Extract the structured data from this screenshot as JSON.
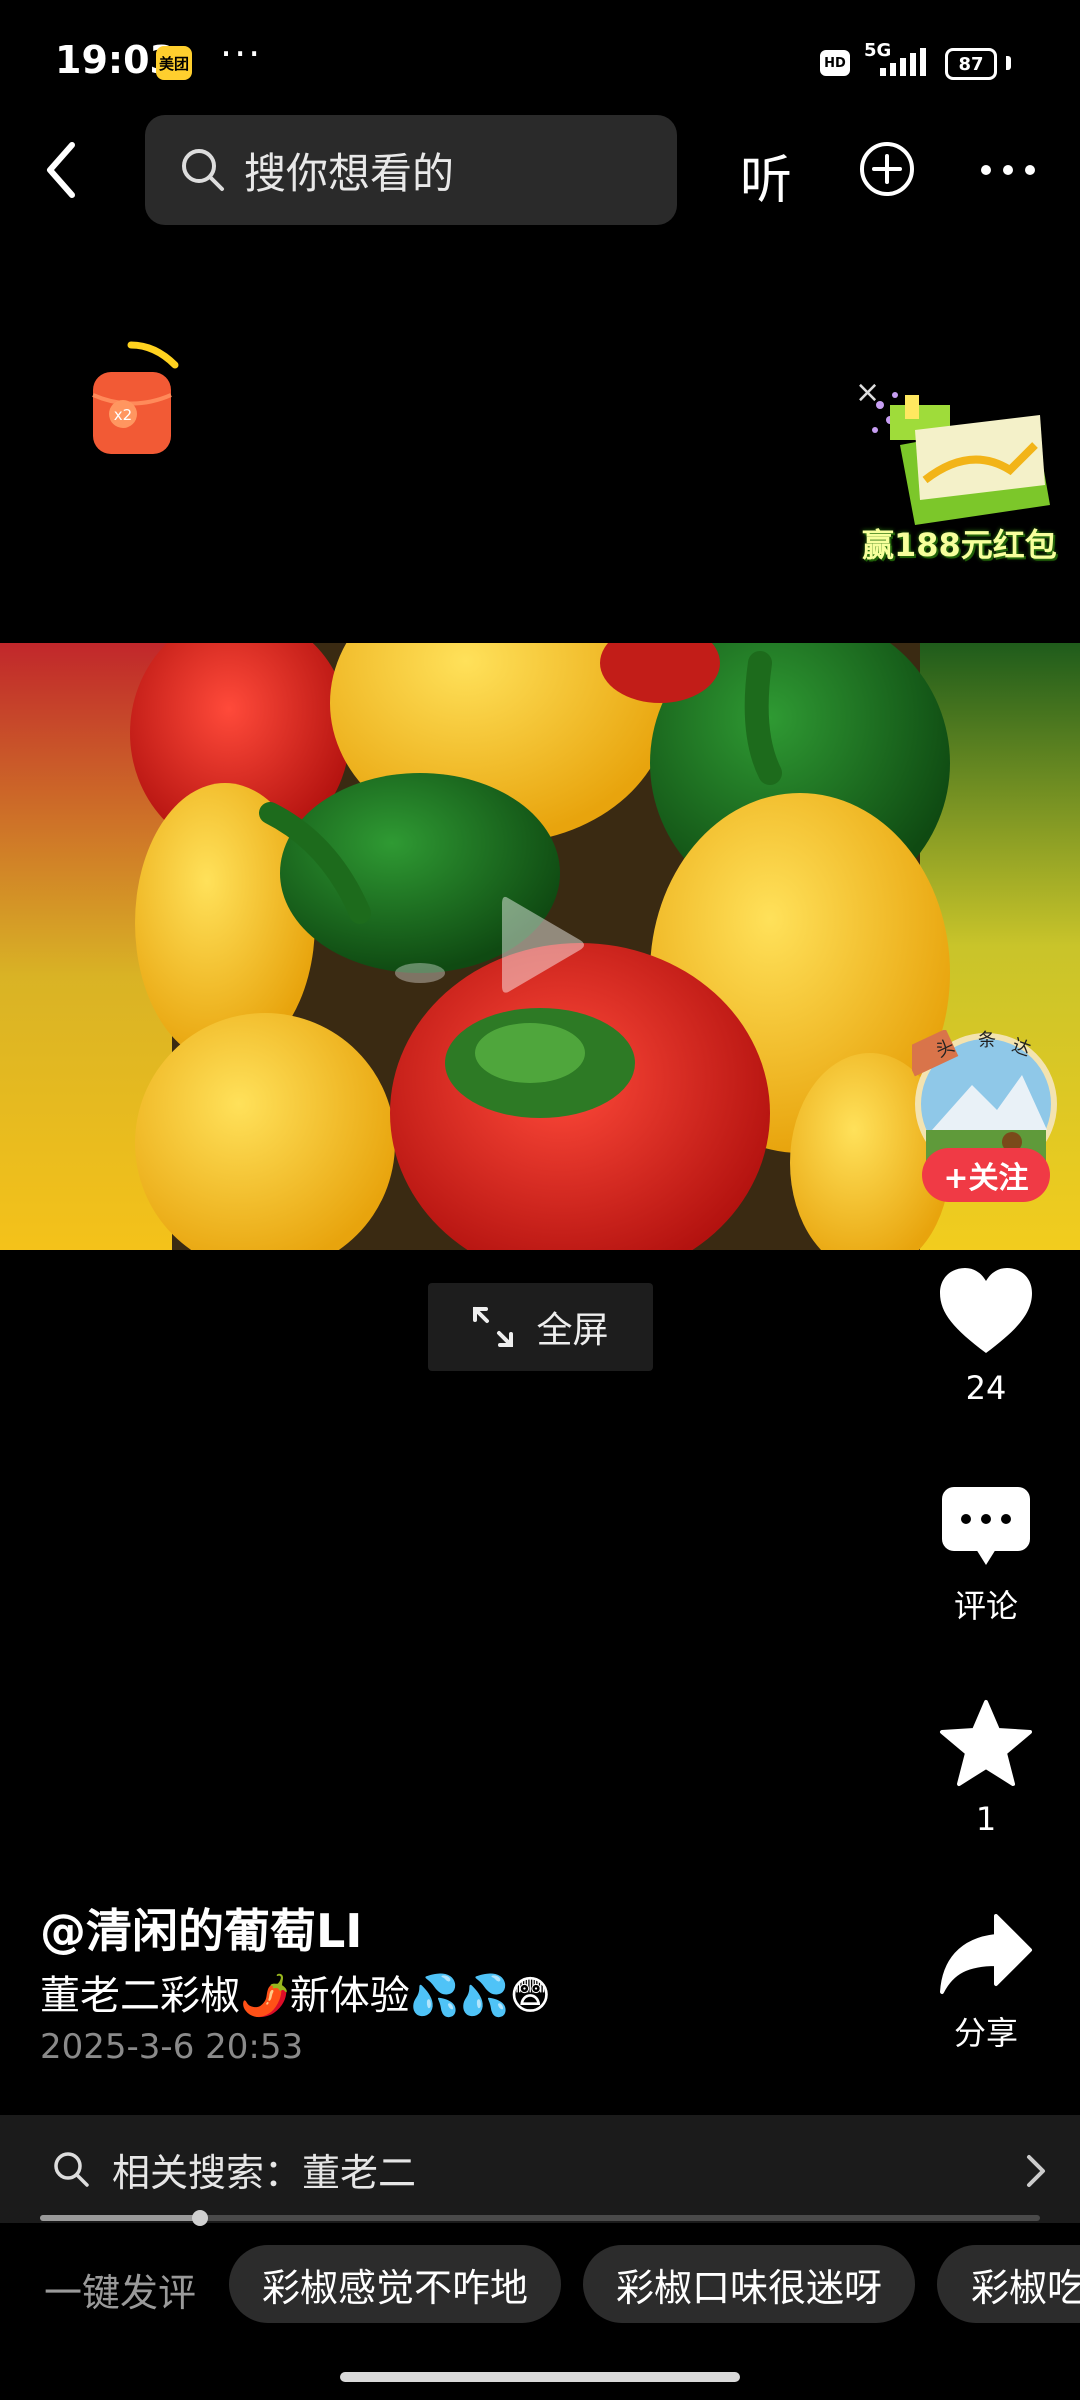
{
  "status_bar": {
    "time": "19:03",
    "app_badge": "美团",
    "more": "···",
    "hd": "HD",
    "network": "5G",
    "battery": "87"
  },
  "nav": {
    "search_placeholder": "搜你想看的",
    "listen_label": "听"
  },
  "banner": {
    "win_text": "赢188元红包",
    "close": "×"
  },
  "video": {
    "fullscreen_label": "全屏"
  },
  "author": {
    "follow_label": "+关注",
    "name": "@清闲的葡萄LI"
  },
  "actions": {
    "likes": "24",
    "comment_label": "评论",
    "favorites": "1",
    "share_label": "分享"
  },
  "post": {
    "caption": "董老二彩椒🌶️新体验💦💦😨",
    "time": "2025-3-6 20:53"
  },
  "related": {
    "label": "相关搜索：董老二"
  },
  "progress": {
    "fraction": 0.16
  },
  "quick_comments": {
    "label": "一键发评",
    "chips": [
      "彩椒感觉不咋地",
      "彩椒口味很迷呀",
      "彩椒吃"
    ]
  },
  "colors": {
    "follow": "#f03a45",
    "background": "#000000"
  }
}
